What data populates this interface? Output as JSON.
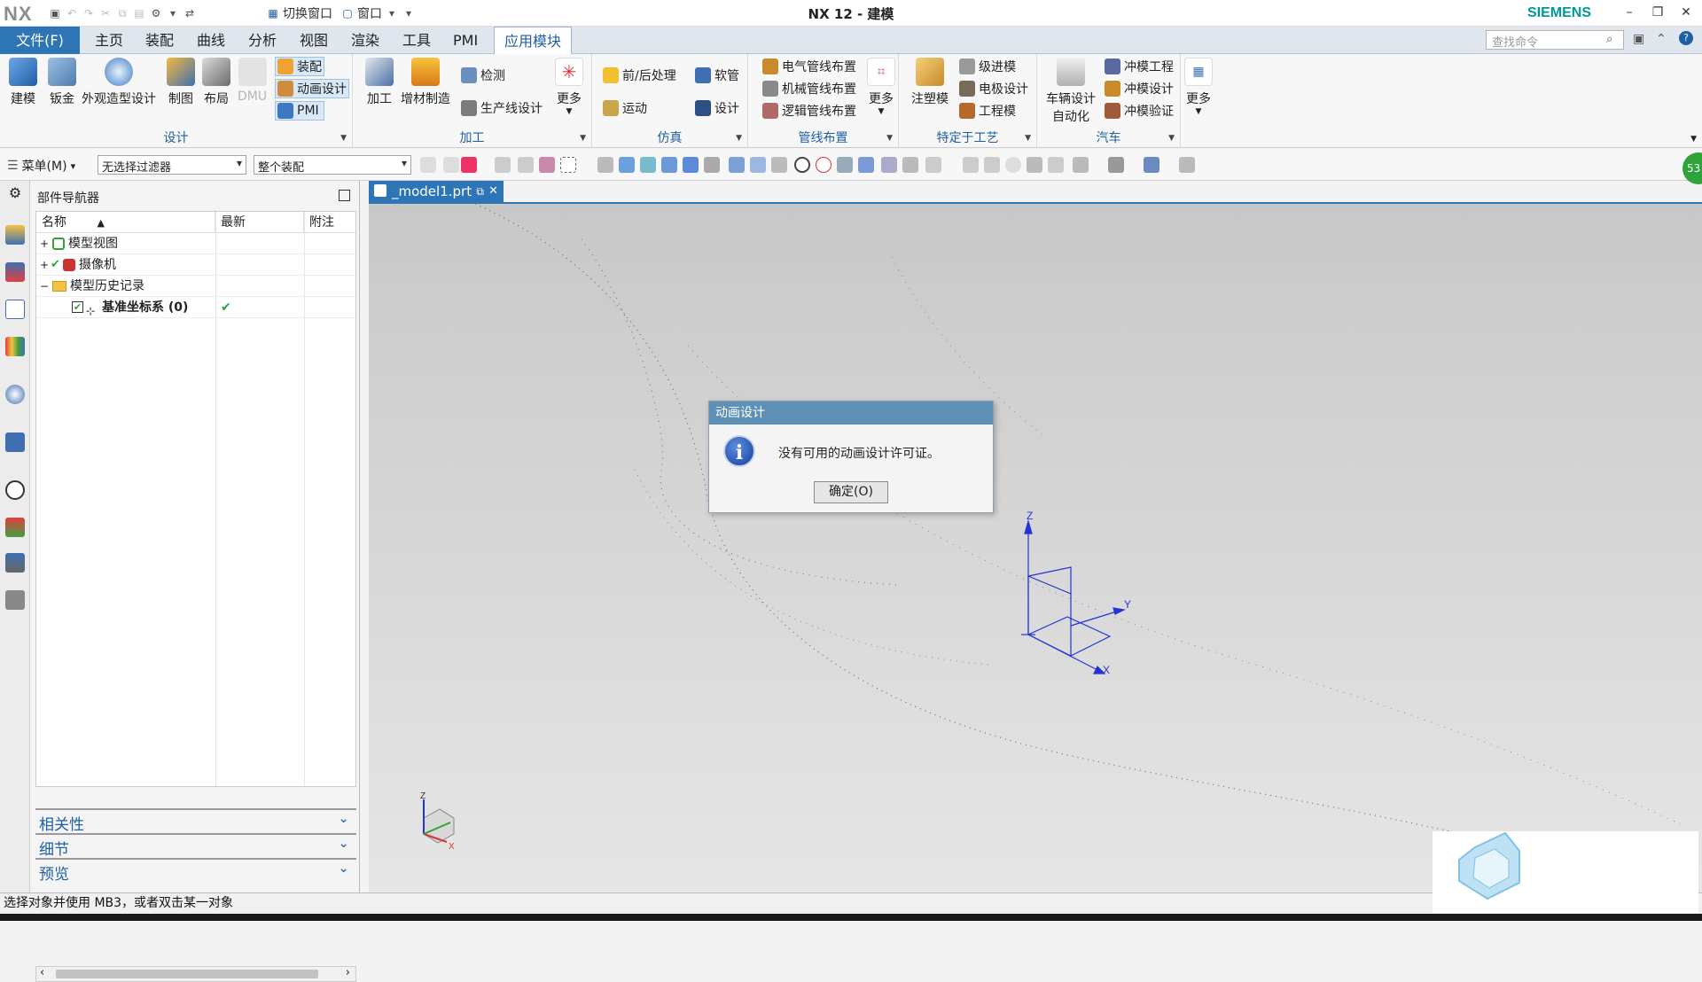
{
  "window": {
    "logo": "NX",
    "title": "NX 12 - 建模",
    "brand": "SIEMENS",
    "switch_window": "切换窗口",
    "window_menu": "窗口"
  },
  "menubar": {
    "file": "文件(F)",
    "tabs": [
      "主页",
      "装配",
      "曲线",
      "分析",
      "视图",
      "渲染",
      "工具",
      "PMI",
      "应用模块"
    ],
    "search_placeholder": "查找命令"
  },
  "ribbon": {
    "design": {
      "label": "设计",
      "items": [
        "建模",
        "钣金",
        "外观造型设计",
        "制图",
        "布局",
        "DMU"
      ],
      "stack": [
        "装配",
        "动画设计",
        "PMI"
      ]
    },
    "machining": {
      "label": "加工",
      "items": [
        "加工",
        "增材制造"
      ],
      "stack": [
        "检测",
        "生产线设计"
      ],
      "more": "更多"
    },
    "simulation": {
      "label": "仿真",
      "stack": [
        "前/后处理",
        "运动",
        "软管",
        "设计"
      ]
    },
    "routing": {
      "label": "管线布置",
      "stack": [
        "电气管线布置",
        "机械管线布置",
        "逻辑管线布置"
      ],
      "more": "更多"
    },
    "process": {
      "label": "特定于工艺",
      "items": [
        "注塑模"
      ],
      "stack": [
        "级进模",
        "电极设计",
        "工程模"
      ]
    },
    "auto": {
      "label": "汽车",
      "items": [
        "车辆设计",
        "自动化"
      ],
      "stack": [
        "冲模工程",
        "冲模设计",
        "冲模验证"
      ]
    },
    "more": "更多"
  },
  "toolbar2": {
    "menu": "菜单(M)",
    "filter": "无选择过滤器",
    "scope": "整个装配"
  },
  "navigator": {
    "title": "部件导航器",
    "columns": [
      "名称",
      "最新",
      "附注"
    ],
    "rows": [
      {
        "name": "模型视图",
        "expander": "+"
      },
      {
        "name": "摄像机",
        "expander": "+"
      },
      {
        "name": "模型历史记录",
        "expander": "−"
      },
      {
        "name": "基准坐标系 (0)",
        "latest": "✔"
      }
    ],
    "panels": [
      "相关性",
      "细节",
      "预览"
    ]
  },
  "doc_tab": {
    "name": "_model1.prt"
  },
  "dialog": {
    "title": "动画设计",
    "message": "没有可用的动画设计许可证。",
    "ok": "确定(O)"
  },
  "status": "选择对象并使用 MB3，或者双击某一对象",
  "badge": "53",
  "axes": {
    "z": "Z",
    "y": "Y",
    "x": "X"
  }
}
